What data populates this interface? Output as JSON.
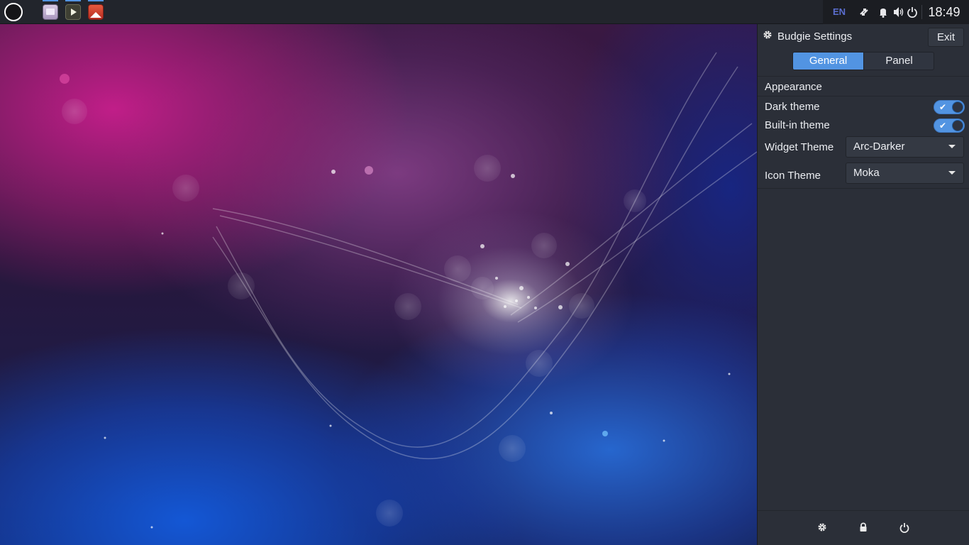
{
  "top_panel": {
    "launchers": [
      {
        "name": "files-icon"
      },
      {
        "name": "media-player-icon"
      },
      {
        "name": "image-viewer-icon"
      }
    ],
    "tray": {
      "language": "EN",
      "clock": "18:49"
    }
  },
  "raven": {
    "title": "Budgie Settings",
    "exit_label": "Exit",
    "tabs": [
      {
        "label": "General",
        "active": true
      },
      {
        "label": "Panel",
        "active": false
      }
    ],
    "appearance": {
      "section_title": "Appearance",
      "dark_theme": {
        "label": "Dark theme",
        "enabled": true
      },
      "builtin_theme": {
        "label": "Built-in theme",
        "enabled": true
      },
      "widget_theme": {
        "label": "Widget Theme",
        "value": "Arc-Darker"
      },
      "icon_theme": {
        "label": "Icon Theme",
        "value": "Moka"
      }
    },
    "footer": {
      "icons": [
        "settings-icon",
        "lock-icon",
        "power-icon"
      ]
    }
  },
  "colors": {
    "accent": "#5294e2",
    "panel_bg": "#22252c",
    "raven_bg": "#2b2f38"
  }
}
